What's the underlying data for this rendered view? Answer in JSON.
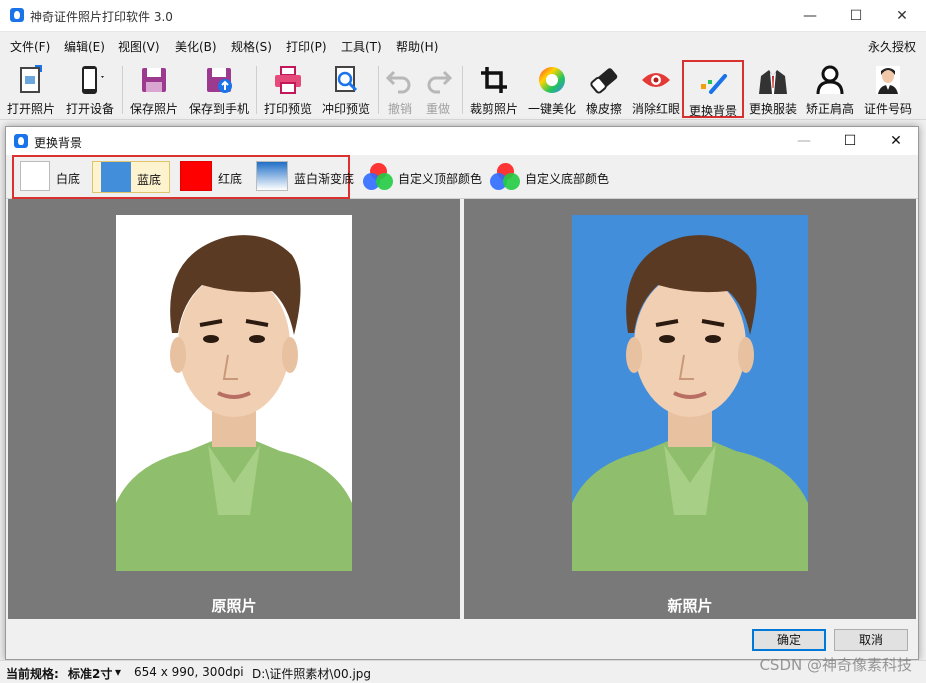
{
  "window": {
    "title": "神奇证件照片打印软件 3.0",
    "controls": [
      "—",
      "☐",
      "✕"
    ]
  },
  "menu": {
    "items": [
      "文件(F)",
      "编辑(E)",
      "视图(V)",
      "美化(B)",
      "规格(S)",
      "打印(P)",
      "工具(T)",
      "帮助(H)"
    ],
    "license": "永久授权"
  },
  "toolbar": {
    "items": [
      {
        "label": "打开照片",
        "icon": "open-photo-icon"
      },
      {
        "label": "打开设备",
        "icon": "phone-device-icon"
      },
      {
        "label": "保存照片",
        "icon": "save-icon"
      },
      {
        "label": "保存到手机",
        "icon": "save-to-phone-icon"
      },
      {
        "label": "打印预览",
        "icon": "printer-icon"
      },
      {
        "label": "冲印预览",
        "icon": "print-preview-icon"
      },
      {
        "label": "撤销",
        "icon": "undo-icon",
        "disabled": true
      },
      {
        "label": "重做",
        "icon": "redo-icon",
        "disabled": true
      },
      {
        "label": "裁剪照片",
        "icon": "crop-icon"
      },
      {
        "label": "一键美化",
        "icon": "color-wheel-icon"
      },
      {
        "label": "橡皮擦",
        "icon": "eraser-icon"
      },
      {
        "label": "消除红眼",
        "icon": "red-eye-icon"
      },
      {
        "label": "更换背景",
        "icon": "change-background-icon",
        "active": true
      },
      {
        "label": "更换服装",
        "icon": "suit-icon"
      },
      {
        "label": "矫正肩高",
        "icon": "shoulder-icon"
      },
      {
        "label": "证件号码",
        "icon": "id-photo-icon"
      }
    ]
  },
  "dialog": {
    "title": "更换背景",
    "bg_options": [
      {
        "label": "白底",
        "color": "#ffffff"
      },
      {
        "label": "蓝底",
        "color": "#438edb",
        "selected": true
      },
      {
        "label": "红底",
        "color": "#ff0000"
      },
      {
        "label": "蓝白渐变底",
        "color": "gradient"
      }
    ],
    "custom_buttons": [
      "自定义顶部颜色",
      "自定义底部颜色"
    ],
    "original_label": "原照片",
    "new_label": "新照片",
    "new_bg_color": "#438edb",
    "ok_label": "确定",
    "cancel_label": "取消"
  },
  "status": {
    "spec_label": "当前规格:",
    "spec_value": "标准2寸",
    "size": "654 x 990, 300dpi",
    "path": "D:\\证件照素材\\00.jpg"
  },
  "watermark": "CSDN @神奇像素科技"
}
